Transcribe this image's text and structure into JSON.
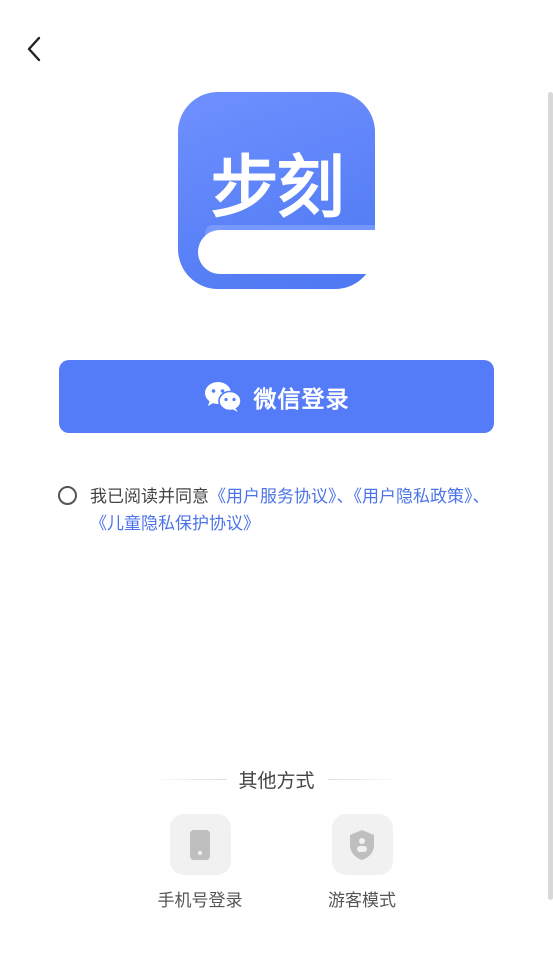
{
  "header": {
    "back_icon": "chevron-left-icon"
  },
  "logo": {
    "text": "步刻",
    "color_top": "#6f90ff",
    "color_bottom": "#4d78f2"
  },
  "wechat_login": {
    "label": "微信登录",
    "icon": "wechat-icon",
    "bg_color": "#557cf8"
  },
  "agreement": {
    "checked": false,
    "prefix": "我已阅读并同意",
    "link_user_agreement": "《用户服务协议》",
    "sep1": "、",
    "link_privacy_policy": "《用户隐私政策》",
    "sep2": "、",
    "link_child_privacy": "《儿童隐私保护协议》",
    "link_color": "#4c74e8"
  },
  "other_methods": {
    "title": "其他方式",
    "options": [
      {
        "label": "手机号登录",
        "icon": "phone-icon"
      },
      {
        "label": "游客模式",
        "icon": "guest-shield-icon"
      }
    ]
  }
}
